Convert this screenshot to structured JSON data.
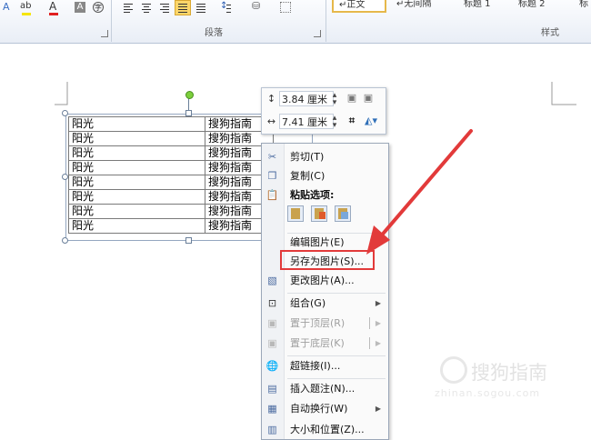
{
  "ribbon": {
    "group_paragraph": "段落",
    "group_styles": "样式",
    "style_normal": "↵正文",
    "style_no_spacing": "↵无间隔",
    "style_heading1": "标题 1",
    "style_heading2": "标题 2",
    "style_more": "标"
  },
  "table": {
    "rows": [
      [
        "阳光",
        "搜狗指南"
      ],
      [
        "阳光",
        "搜狗指南"
      ],
      [
        "阳光",
        "搜狗指南"
      ],
      [
        "阳光",
        "搜狗指南"
      ],
      [
        "阳光",
        "搜狗指南"
      ],
      [
        "阳光",
        "搜狗指南"
      ],
      [
        "阳光",
        "搜狗指南"
      ],
      [
        "阳光",
        "搜狗指南"
      ]
    ]
  },
  "mini_toolbar": {
    "height_value": "3.84 厘米",
    "width_value": "7.41 厘米"
  },
  "context_menu": {
    "cut": "剪切(T)",
    "copy": "复制(C)",
    "paste_options": "粘贴选项:",
    "edit_picture": "编辑图片(E)",
    "save_as_picture": "另存为图片(S)...",
    "change_picture": "更改图片(A)...",
    "group": "组合(G)",
    "bring_to_front": "置于顶层(R)",
    "send_to_back": "置于底层(K)",
    "hyperlink": "超链接(I)...",
    "insert_caption": "插入题注(N)...",
    "wrap_text": "自动换行(W)",
    "size_position": "大小和位置(Z)..."
  },
  "watermark": {
    "text": "搜狗指南",
    "url": "zhinan.sogou.com"
  },
  "colors": {
    "highlight_red": "#e23a3a",
    "arrow_red": "#e23a3a",
    "rotate_handle": "#7ccf3c"
  }
}
